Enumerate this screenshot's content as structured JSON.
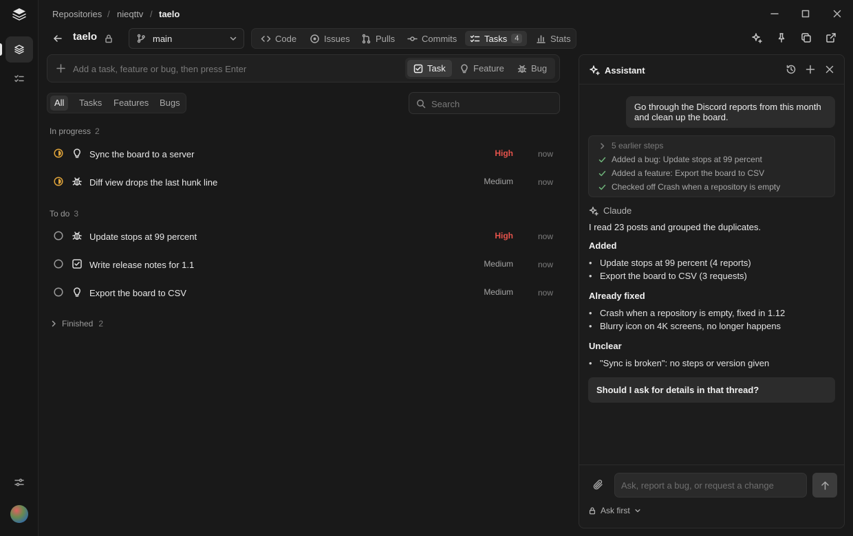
{
  "breadcrumb": [
    "Repositories",
    "nieqttv",
    "taelo"
  ],
  "repo": {
    "name": "taelo",
    "branch": "main"
  },
  "tabs": [
    {
      "label": "Code",
      "icon": "code-icon"
    },
    {
      "label": "Issues",
      "icon": "issue-icon"
    },
    {
      "label": "Pulls",
      "icon": "pull-request-icon"
    },
    {
      "label": "Commits",
      "icon": "commit-icon"
    },
    {
      "label": "Tasks",
      "icon": "tasks-icon",
      "count": "4",
      "active": true
    },
    {
      "label": "Stats",
      "icon": "bar-chart-icon"
    }
  ],
  "add_bar": {
    "placeholder": "Add a task, feature or bug, then press Enter",
    "types": [
      "Task",
      "Feature",
      "Bug"
    ],
    "active_type": "Task"
  },
  "filters": [
    "All",
    "Tasks",
    "Features",
    "Bugs"
  ],
  "search": {
    "placeholder": "Search"
  },
  "groups": {
    "in_progress": {
      "label": "In progress",
      "count": "2",
      "items": [
        {
          "title": "Sync the board to a server",
          "kind": "feature",
          "priority": "High",
          "time": "now"
        },
        {
          "title": "Diff view drops the last hunk line",
          "kind": "bug",
          "priority": "Medium",
          "time": "now"
        }
      ]
    },
    "todo": {
      "label": "To do",
      "count": "3",
      "items": [
        {
          "title": "Update stops at 99 percent",
          "kind": "bug",
          "priority": "High",
          "time": "now"
        },
        {
          "title": "Write release notes for 1.1",
          "kind": "task",
          "priority": "Medium",
          "time": "now"
        },
        {
          "title": "Export the board to CSV",
          "kind": "feature",
          "priority": "Medium",
          "time": "now"
        }
      ]
    },
    "finished": {
      "label": "Finished",
      "count": "2"
    }
  },
  "assistant": {
    "title": "Assistant",
    "user_message": "Go through the Discord reports from this month and clean up the board.",
    "steps": [
      "5 earlier steps",
      "Added a bug: Update stops at 99 percent",
      "Added a feature: Export the board to CSV",
      "Checked off Crash when a repository is empty"
    ],
    "claude_label": "Claude",
    "response": {
      "intro": "I read 23 posts and grouped the duplicates.",
      "added_heading": "Added",
      "added": [
        "Update stops at 99 percent (4 reports)",
        "Export the board to CSV (3 requests)"
      ],
      "fixed_heading": "Already fixed",
      "fixed": [
        "Crash when a repository is empty, fixed in 1.12",
        "Blurry icon on 4K screens, no longer happens"
      ],
      "unclear_heading": "Unclear",
      "unclear": [
        "\"Sync is broken\": no steps or version given"
      ]
    },
    "suggestion": "Should I ask for details in that thread?",
    "input_placeholder": "Ask, report a bug, or request a change",
    "mode": "Ask first"
  },
  "colors": {
    "high": "#e5534b",
    "in_progress": "#e0a43a",
    "bug": "#e5534b",
    "feature": "#5fbf86",
    "done_check": "#6fb57a"
  }
}
